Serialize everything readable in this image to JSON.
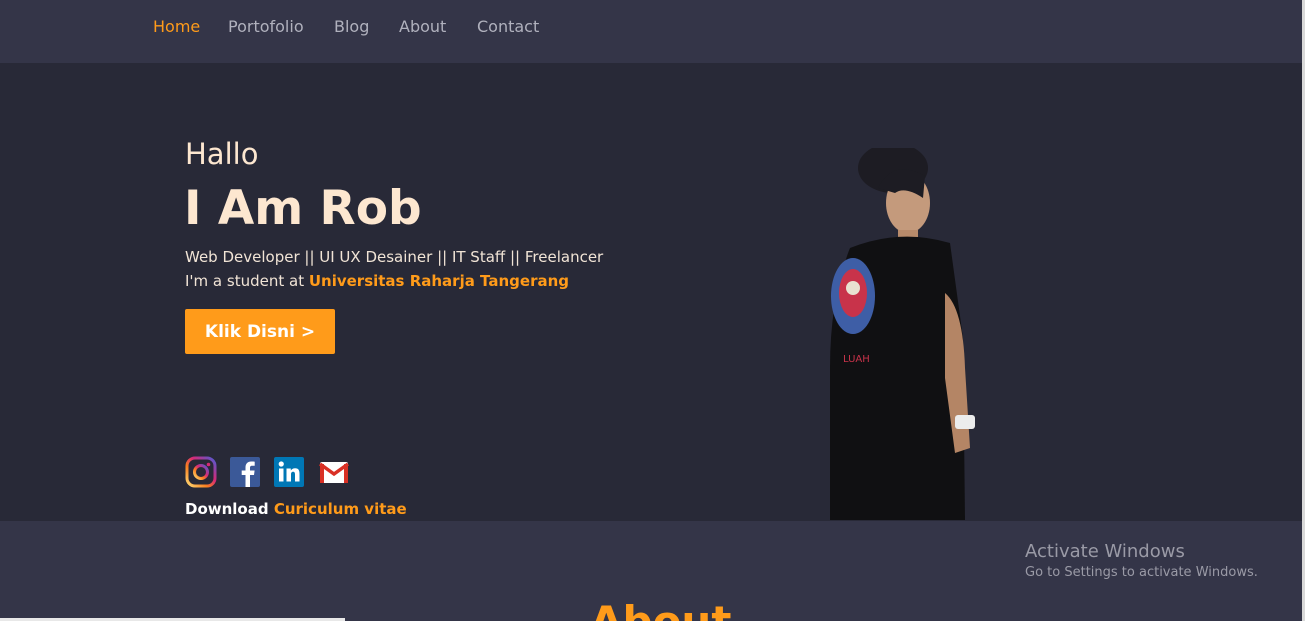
{
  "nav": {
    "items": [
      {
        "label": "Home",
        "active": true
      },
      {
        "label": "Portofolio"
      },
      {
        "label": "Blog"
      },
      {
        "label": "About"
      },
      {
        "label": "Contact"
      }
    ]
  },
  "hero": {
    "greeting": "Hallo",
    "name": "I Am Rob",
    "roles": "Web Developer || UI UX Desainer || IT Staff || Freelancer",
    "student_prefix": "I'm a student at ",
    "university": "Universitas Raharja Tangerang",
    "cta_label": "Klik Disni >",
    "social_icons": [
      "instagram-icon",
      "facebook-icon",
      "linkedin-icon",
      "gmail-icon"
    ],
    "download_prefix": "Download ",
    "download_link": "Curiculum vitae"
  },
  "about": {
    "title": "About"
  },
  "watermark": {
    "title": "Activate Windows",
    "subtitle": "Go to Settings to activate Windows."
  },
  "colors": {
    "accent": "#ff9b1a",
    "navbar_bg": "#343548",
    "hero_bg": "#282937",
    "heading_text": "#fde7d0"
  }
}
